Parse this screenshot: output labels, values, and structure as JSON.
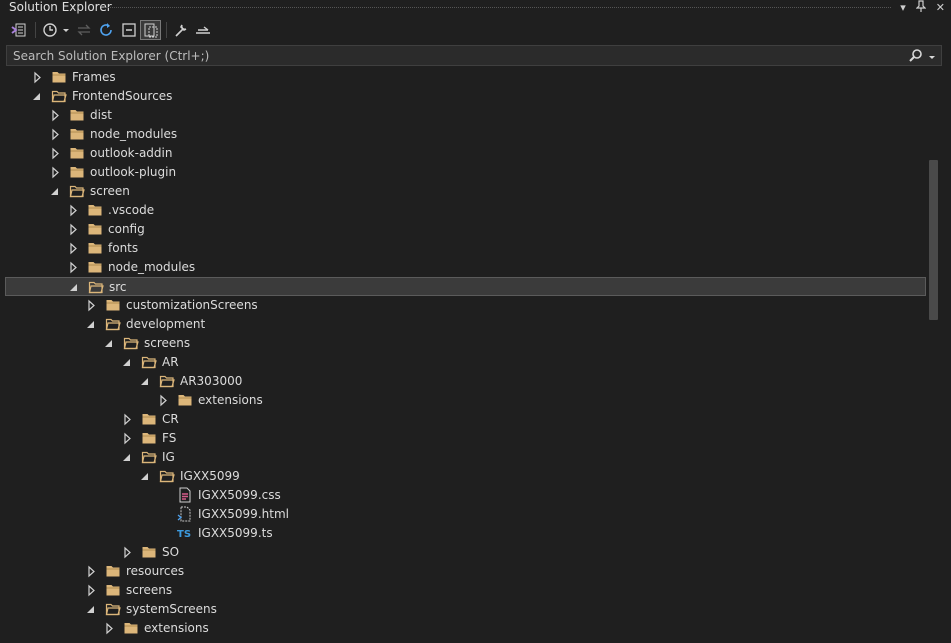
{
  "window": {
    "title": "Solution Explorer",
    "dropdown_icon": "chevron-down-icon",
    "pin_icon": "pin-icon",
    "close_icon": "close-icon"
  },
  "toolbar": {
    "buttons": [
      "vs-solution-switch-icon",
      "history-icon",
      "sync-icon",
      "refresh-icon",
      "collapse-all-icon",
      "show-all-files-icon",
      "properties-icon",
      "preview-icon"
    ]
  },
  "search": {
    "placeholder": "Search Solution Explorer (Ctrl+;)"
  },
  "colors": {
    "folder": "#dcb67a",
    "css": "#d65c8a",
    "ts": "#3c9be0",
    "html": "#c7c7c7"
  },
  "tree": [
    {
      "label": "Frames",
      "level": 1,
      "expanded": false,
      "type": "folder"
    },
    {
      "label": "FrontendSources",
      "level": 1,
      "expanded": true,
      "type": "folder"
    },
    {
      "label": "dist",
      "level": 2,
      "expanded": false,
      "type": "folder"
    },
    {
      "label": "node_modules",
      "level": 2,
      "expanded": false,
      "type": "folder"
    },
    {
      "label": "outlook-addin",
      "level": 2,
      "expanded": false,
      "type": "folder"
    },
    {
      "label": "outlook-plugin",
      "level": 2,
      "expanded": false,
      "type": "folder"
    },
    {
      "label": "screen",
      "level": 2,
      "expanded": true,
      "type": "folder"
    },
    {
      "label": ".vscode",
      "level": 3,
      "expanded": false,
      "type": "folder"
    },
    {
      "label": "config",
      "level": 3,
      "expanded": false,
      "type": "folder"
    },
    {
      "label": "fonts",
      "level": 3,
      "expanded": false,
      "type": "folder"
    },
    {
      "label": "node_modules",
      "level": 3,
      "expanded": false,
      "type": "folder"
    },
    {
      "label": "src",
      "level": 3,
      "expanded": true,
      "type": "folder",
      "selected": true
    },
    {
      "label": "customizationScreens",
      "level": 4,
      "expanded": false,
      "type": "folder"
    },
    {
      "label": "development",
      "level": 4,
      "expanded": true,
      "type": "folder"
    },
    {
      "label": "screens",
      "level": 5,
      "expanded": true,
      "type": "folder"
    },
    {
      "label": "AR",
      "level": 6,
      "expanded": true,
      "type": "folder"
    },
    {
      "label": "AR303000",
      "level": 7,
      "expanded": true,
      "type": "folder"
    },
    {
      "label": "extensions",
      "level": 8,
      "expanded": false,
      "type": "folder"
    },
    {
      "label": "CR",
      "level": 6,
      "expanded": false,
      "type": "folder"
    },
    {
      "label": "FS",
      "level": 6,
      "expanded": false,
      "type": "folder"
    },
    {
      "label": "IG",
      "level": 6,
      "expanded": true,
      "type": "folder"
    },
    {
      "label": "IGXX5099",
      "level": 7,
      "expanded": true,
      "type": "folder"
    },
    {
      "label": "IGXX5099.css",
      "level": 8,
      "type": "css"
    },
    {
      "label": "IGXX5099.html",
      "level": 8,
      "type": "html"
    },
    {
      "label": "IGXX5099.ts",
      "level": 8,
      "type": "ts"
    },
    {
      "label": "SO",
      "level": 6,
      "expanded": false,
      "type": "folder"
    },
    {
      "label": "resources",
      "level": 4,
      "expanded": false,
      "type": "folder"
    },
    {
      "label": "screens",
      "level": 4,
      "expanded": false,
      "type": "folder"
    },
    {
      "label": "systemScreens",
      "level": 4,
      "expanded": true,
      "type": "folder"
    },
    {
      "label": "extensions",
      "level": 5,
      "expanded": false,
      "type": "folder"
    }
  ]
}
